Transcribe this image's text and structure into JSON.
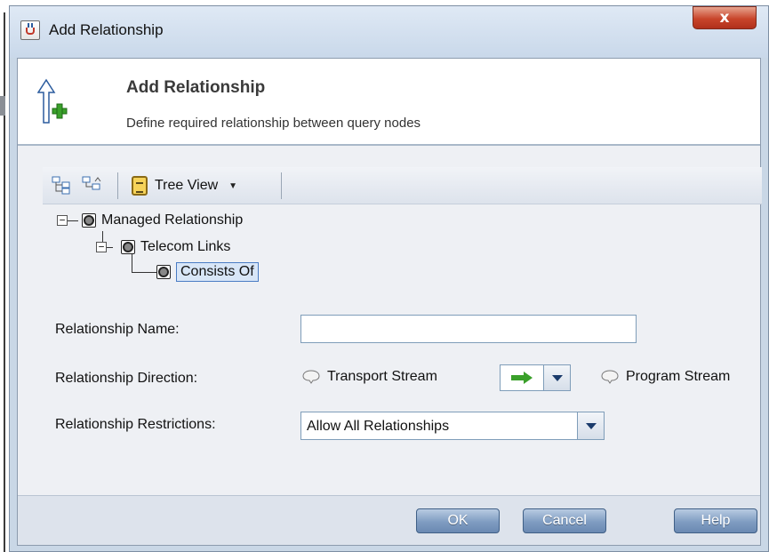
{
  "window": {
    "title": "Add Relationship",
    "close_label": "x"
  },
  "header": {
    "title": "Add Relationship",
    "subtitle": "Define required relationship between query nodes",
    "icon": "arrow-up-plus-icon"
  },
  "toolbar": {
    "expand_icon": "expand-all-icon",
    "collapse_icon": "collapse-all-icon",
    "tree_view_label": "Tree View",
    "tree_view_icon": "clipboard-icon"
  },
  "tree": {
    "nodes": [
      {
        "label": "Managed Relationship",
        "expanded": true,
        "selected": false
      },
      {
        "label": "Telecom Links",
        "expanded": true,
        "selected": false
      },
      {
        "label": "Consists Of",
        "selected": true
      }
    ]
  },
  "form": {
    "name_label": "Relationship Name:",
    "name_value": "",
    "direction_label": "Relationship Direction:",
    "direction_from": "Transport Stream",
    "direction_to": "Program Stream",
    "direction_arrow_color": "#3aa02a",
    "restrictions_label": "Relationship Restrictions:",
    "restrictions_value": "Allow All Relationships"
  },
  "buttons": {
    "ok": "OK",
    "cancel": "Cancel",
    "help": "Help"
  },
  "colors": {
    "close_button": "#c8452b",
    "accent_button": "#7f9cc1",
    "header_plus": "#3aa02a"
  }
}
